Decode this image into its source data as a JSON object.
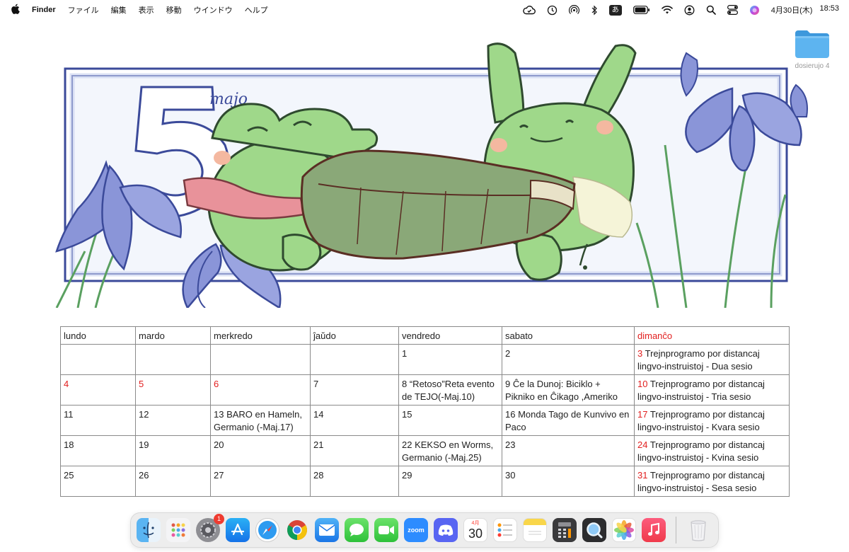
{
  "menubar": {
    "apple": "",
    "app_name": "Finder",
    "menus": [
      "ファイル",
      "編集",
      "表示",
      "移動",
      "ウインドウ",
      "ヘルプ"
    ],
    "ime_label": "あ",
    "date": "4月30日(木)",
    "time": "18:53"
  },
  "desktop": {
    "folder_name": "dosierujo 4"
  },
  "banner": {
    "month_number": "5",
    "month_word": "majo"
  },
  "calendar": {
    "headers": [
      "lundo",
      "mardo",
      "merkredo",
      "ĵaŭdo",
      "vendredo",
      "sabato",
      "dimanĉo"
    ],
    "rows": [
      [
        {
          "day": "",
          "text": ""
        },
        {
          "day": "",
          "text": ""
        },
        {
          "day": "",
          "text": ""
        },
        {
          "day": "",
          "text": ""
        },
        {
          "day": "1",
          "text": ""
        },
        {
          "day": "2",
          "text": ""
        },
        {
          "day": "3",
          "text": " Trejnprogramo por distancaj lingvo-instruistoj - Dua sesio"
        }
      ],
      [
        {
          "day": "4",
          "text": ""
        },
        {
          "day": "5",
          "text": ""
        },
        {
          "day": "6",
          "text": ""
        },
        {
          "day": "7",
          "text": ""
        },
        {
          "day": "8",
          "text": " “Retoso”Reta evento de TEJO(-Maj.10)"
        },
        {
          "day": "9",
          "text": " Ĉe la Dunoj: Biciklo + Pikniko en Ĉikago ,Ameriko"
        },
        {
          "day": "10",
          "text": " Trejnprogramo por distancaj lingvo-instruistoj - Tria sesio"
        }
      ],
      [
        {
          "day": "11",
          "text": ""
        },
        {
          "day": "12",
          "text": ""
        },
        {
          "day": "13",
          "text": " BARO en Hameln, Germanio (-Maj.17)"
        },
        {
          "day": "14",
          "text": ""
        },
        {
          "day": "15",
          "text": ""
        },
        {
          "day": "16",
          "text": " Monda Tago de Kunvivo en Paco"
        },
        {
          "day": "17",
          "text": " Trejnprogramo por distancaj lingvo-instruistoj - Kvara sesio"
        }
      ],
      [
        {
          "day": "18",
          "text": ""
        },
        {
          "day": "19",
          "text": ""
        },
        {
          "day": "20",
          "text": ""
        },
        {
          "day": "21",
          "text": ""
        },
        {
          "day": "22",
          "text": " KEKSO en Worms, Germanio (-Maj.25)"
        },
        {
          "day": "23",
          "text": ""
        },
        {
          "day": "24",
          "text": " Trejnprogramo por distancaj lingvo-instruistoj - Kvina sesio"
        }
      ],
      [
        {
          "day": "25",
          "text": ""
        },
        {
          "day": "26",
          "text": ""
        },
        {
          "day": "27",
          "text": ""
        },
        {
          "day": "28",
          "text": ""
        },
        {
          "day": "29",
          "text": ""
        },
        {
          "day": "30",
          "text": ""
        },
        {
          "day": "31",
          "text": " Trejnprogramo por distancaj lingvo-instruistoj - Sesa sesio"
        }
      ]
    ]
  },
  "dock": {
    "settings_badge": "1",
    "calendar_month": "4月",
    "calendar_day": "30",
    "zoom_label": "zoom"
  },
  "colors": {
    "holiday_red": "#e22020",
    "iris_purple": "#8a95d8",
    "frog_green": "#9fd88a",
    "leaf_green": "#8aa878",
    "frame_blue": "#3b4a9a"
  }
}
